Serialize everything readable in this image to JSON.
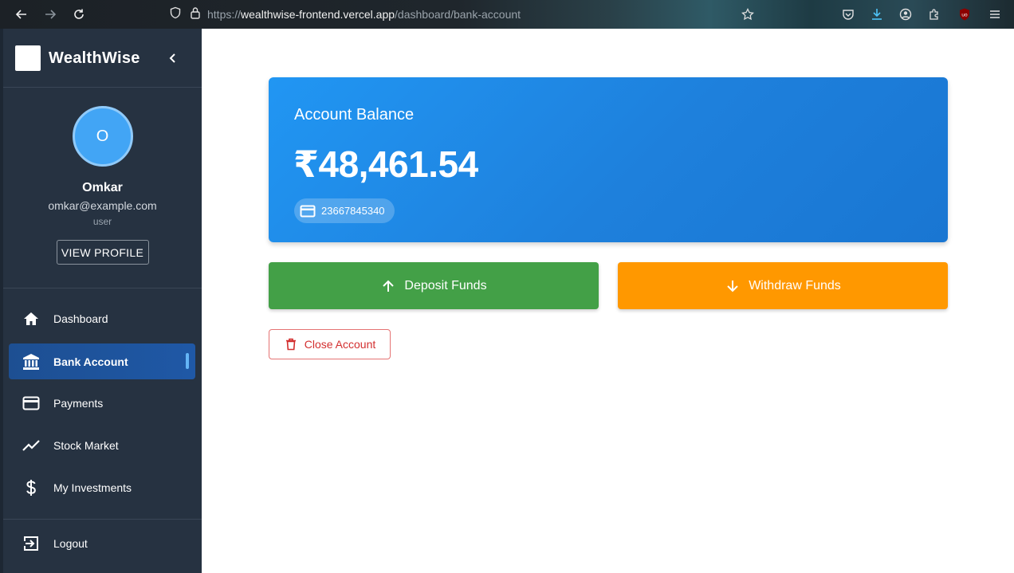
{
  "browser": {
    "url_prefix": "https://",
    "url_host": "wealthwise-frontend.vercel.app",
    "url_path": "/dashboard/bank-account",
    "icons": [
      "back-icon",
      "forward-icon",
      "reload-icon",
      "shield-icon",
      "lock-icon",
      "star-icon",
      "pocket-icon",
      "download-icon",
      "account-icon",
      "extensions-icon",
      "ublock-icon",
      "menu-icon"
    ],
    "ublock_badge": "uo"
  },
  "sidebar": {
    "brand": "WealthWise",
    "profile": {
      "initial": "O",
      "name": "Omkar",
      "email": "omkar@example.com",
      "role": "user",
      "view_profile_label": "VIEW PROFILE"
    },
    "items": [
      {
        "label": "Dashboard",
        "icon": "home-icon",
        "active": false
      },
      {
        "label": "Bank Account",
        "icon": "bank-icon",
        "active": true
      },
      {
        "label": "Payments",
        "icon": "credit-card-icon",
        "active": false
      },
      {
        "label": "Stock Market",
        "icon": "trending-up-icon",
        "active": false
      },
      {
        "label": "My Investments",
        "icon": "dollar-icon",
        "active": false
      }
    ],
    "logout_label": "Logout"
  },
  "account": {
    "balance_label": "Account Balance",
    "balance_amount": "₹48,461.54",
    "account_number": "23667845340"
  },
  "actions": {
    "deposit_label": "Deposit Funds",
    "withdraw_label": "Withdraw Funds",
    "close_label": "Close Account"
  },
  "colors": {
    "sidebar_bg": "#263241",
    "card_blue": "#2196f3",
    "deposit_green": "#43a047",
    "withdraw_orange": "#ff9800",
    "close_red": "#d32f2f"
  }
}
